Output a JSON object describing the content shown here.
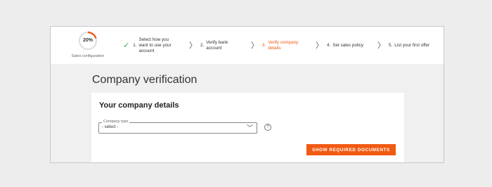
{
  "progress": {
    "percent_label": "20%",
    "fraction": 0.2,
    "caption": "Sales configuration",
    "accent_color": "#f05a14",
    "track_color": "#dddddd"
  },
  "steps": [
    {
      "icon": "check-icon",
      "number": "1.",
      "label": "Select how you\nwant to use your\naccount",
      "state": "done"
    },
    {
      "icon": "chevron-right-icon",
      "number": "2.",
      "label": "Verify bank\naccount",
      "state": "pending"
    },
    {
      "icon": "chevron-right-icon",
      "number": "3.",
      "label": "Verify company\ndetails",
      "state": "active"
    },
    {
      "icon": "chevron-right-icon",
      "number": "4.",
      "label": "Set sales policy",
      "state": "pending"
    },
    {
      "icon": "chevron-right-icon",
      "number": "5.",
      "label": "List your first offer",
      "state": "pending"
    }
  ],
  "page": {
    "title": "Company verification"
  },
  "card": {
    "title": "Your company details",
    "company_type": {
      "legend": "Company type",
      "value": "- select -",
      "icon": "chevron-down-icon"
    },
    "help_icon": "question-circle-icon",
    "help_glyph": "?",
    "button_label": "Show required documents"
  },
  "colors": {
    "accent": "#f15a12",
    "success": "#2fa84f"
  }
}
